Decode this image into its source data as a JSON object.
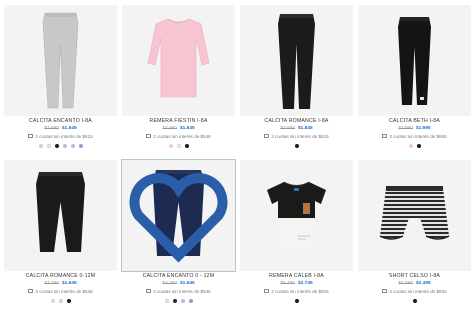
{
  "colors": {
    "price_blue": "#1f6ed4",
    "image_bg": "#f3f3f3",
    "hover_outline": "#b9c4cf"
  },
  "products": [
    {
      "title": "CALCITA ENCANTO I-8A",
      "old_price": "$3.890",
      "price": "$1.645",
      "installments": "3 cuotas sin interés de $615",
      "garment": "leggings",
      "garment_color": "#c8c8c8",
      "swatches": [
        "#d9d9d9",
        "#e8e3da",
        "#1c1c1c",
        "#a7c3dc",
        "#c9b4dc",
        "#b08fd0"
      ]
    },
    {
      "title": "REMERA FIESTIN I-8A",
      "old_price": "$3.890",
      "price": "$1.645",
      "installments": "3 cuotas sin interés de $548",
      "garment": "longsleeve",
      "garment_color": "#f7c4d1",
      "swatches": [
        "#f6cad6",
        "#ececec",
        "#1c1c1c"
      ]
    },
    {
      "title": "CALCITA ROMANCE I-8A",
      "old_price": "$3.690",
      "price": "$1.845",
      "installments": "3 cuotas sin interés de $615",
      "garment": "leggings",
      "garment_color": "#1b1b1d",
      "swatches": [
        "#1c1c1c"
      ]
    },
    {
      "title": "CALCITA BETH I-8A",
      "old_price": "$3.990",
      "price": "$1.995",
      "installments": "3 cuotas sin interés de $665",
      "garment": "leggings",
      "garment_color": "#141416",
      "swatches": [
        "#f3c9d4",
        "#1c1c1c"
      ]
    },
    {
      "title": "CALCITA ROMANCE 0-12M",
      "old_price": "$3.290",
      "price": "$1.645",
      "installments": "3 cuotas sin interés de $548",
      "garment": "shortleggings",
      "garment_color": "#1a1a1c",
      "swatches": [
        "#e7e1d8",
        "#d9d9d9",
        "#1c1c1c"
      ]
    },
    {
      "title": "CALCITA ENCANTO 0 - 12M",
      "old_price": "$3.290",
      "price": "$1.645",
      "installments": "3 cuotas sin interés de $548",
      "garment": "shortleggings",
      "garment_color": "#1d2a52",
      "swatches": [
        "#e7e1d8",
        "#1c2a4e",
        "#a7c3dc",
        "#b08fd0"
      ]
    },
    {
      "title": "REMERA CALEB I-8A",
      "old_price": "$5.490",
      "price": "$2.745",
      "installments": "3 cuotas sin interés de $915",
      "garment": "tshirt",
      "garment_color": "#1a1a1a",
      "swatches": [
        "#1c1c1c"
      ]
    },
    {
      "title": "SHORT CELSO I-8A",
      "old_price": "$4.990",
      "price": "$2.495",
      "installments": "3 cuotas sin interés de $832",
      "garment": "shorts",
      "garment_color": "#d0d0d0",
      "swatches": [
        "#1c1c1c"
      ]
    }
  ]
}
